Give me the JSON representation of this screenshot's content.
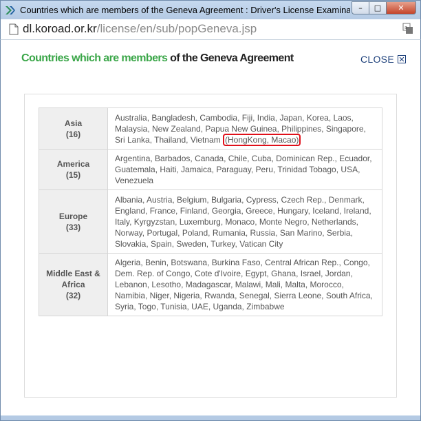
{
  "window": {
    "title": "Countries which are members of the Geneva Agreement : Driver's License Examina...",
    "min_label": "–",
    "max_label": "□",
    "close_label": "✕"
  },
  "address": {
    "host": "dl.koroad.or.kr",
    "path": "/license/en/sub/popGeneva.jsp"
  },
  "heading": {
    "highlight": "Countries which are members",
    "rest": " of the Geneva Agreement"
  },
  "close_link": {
    "label": "CLOSE"
  },
  "colors": {
    "accent_green": "#3aa648",
    "link_blue": "#1c3f7a",
    "highlight_red": "#e0101a"
  },
  "icons": [
    "app-logo-icon",
    "page-icon",
    "translate-icon",
    "close-box-icon"
  ],
  "regions": [
    {
      "name": "Asia",
      "count": "(16)",
      "countries": "Australia, Bangladesh, Cambodia, Fiji, India, Japan, Korea, Laos, Malaysia, New Zealand, Papua New Guinea, Philippines, Singapore, Sri Lanka, Thailand, Vietnam ",
      "highlighted": "(HongKong, Macao)"
    },
    {
      "name": "America",
      "count": "(15)",
      "countries": "Argentina, Barbados, Canada, Chile, Cuba, Dominican Rep., Ecuador, Guatemala, Haiti, Jamaica, Paraguay, Peru, Trinidad Tobago, USA, Venezuela"
    },
    {
      "name": "Europe",
      "count": "(33)",
      "countries": "Albania, Austria, Belgium, Bulgaria, Cypress, Czech Rep., Denmark, England, France, Finland, Georgia, Greece, Hungary, Iceland, Ireland, Italy, Kyrgyzstan, Luxemburg, Monaco, Monte Negro, Netherlands, Norway, Portugal, Poland, Rumania, Russia, San Marino, Serbia, Slovakia, Spain, Sweden, Turkey, Vatican City"
    },
    {
      "name": "Middle East & Africa",
      "count": "(32)",
      "countries": "Algeria, Benin, Botswana, Burkina Faso, Central African Rep., Congo, Dem. Rep. of Congo, Cote d'Ivoire, Egypt, Ghana, Israel, Jordan, Lebanon, Lesotho, Madagascar, Malawi, Mali, Malta, Morocco, Namibia, Niger, Nigeria, Rwanda, Senegal, Sierra Leone, South Africa, Syria, Togo, Tunisia, UAE, Uganda, Zimbabwe"
    }
  ]
}
